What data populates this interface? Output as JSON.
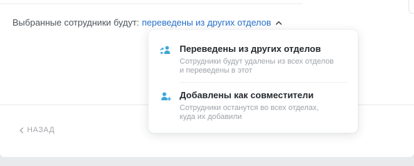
{
  "selection": {
    "prefix": "Выбранные сотрудники будут:",
    "value": "переведены из других отделов"
  },
  "footer": {
    "back_label": "НАЗАД"
  },
  "dropdown": {
    "options": [
      {
        "title": "Переведены из других отделов",
        "line1": "Сотрудники будут удалены из всех отделов",
        "line2": "и переведены в этот",
        "icon": "transfer-user-icon"
      },
      {
        "title": "Добавлены как совместители",
        "line1": "Сотрудники останутся во всех отделах,",
        "line2": "куда их добавили",
        "icon": "add-user-icon"
      }
    ]
  },
  "colors": {
    "accent": "#2770c8",
    "icon": "#3aa6d8",
    "text": "#262a2f",
    "muted": "#9fa3a8"
  }
}
